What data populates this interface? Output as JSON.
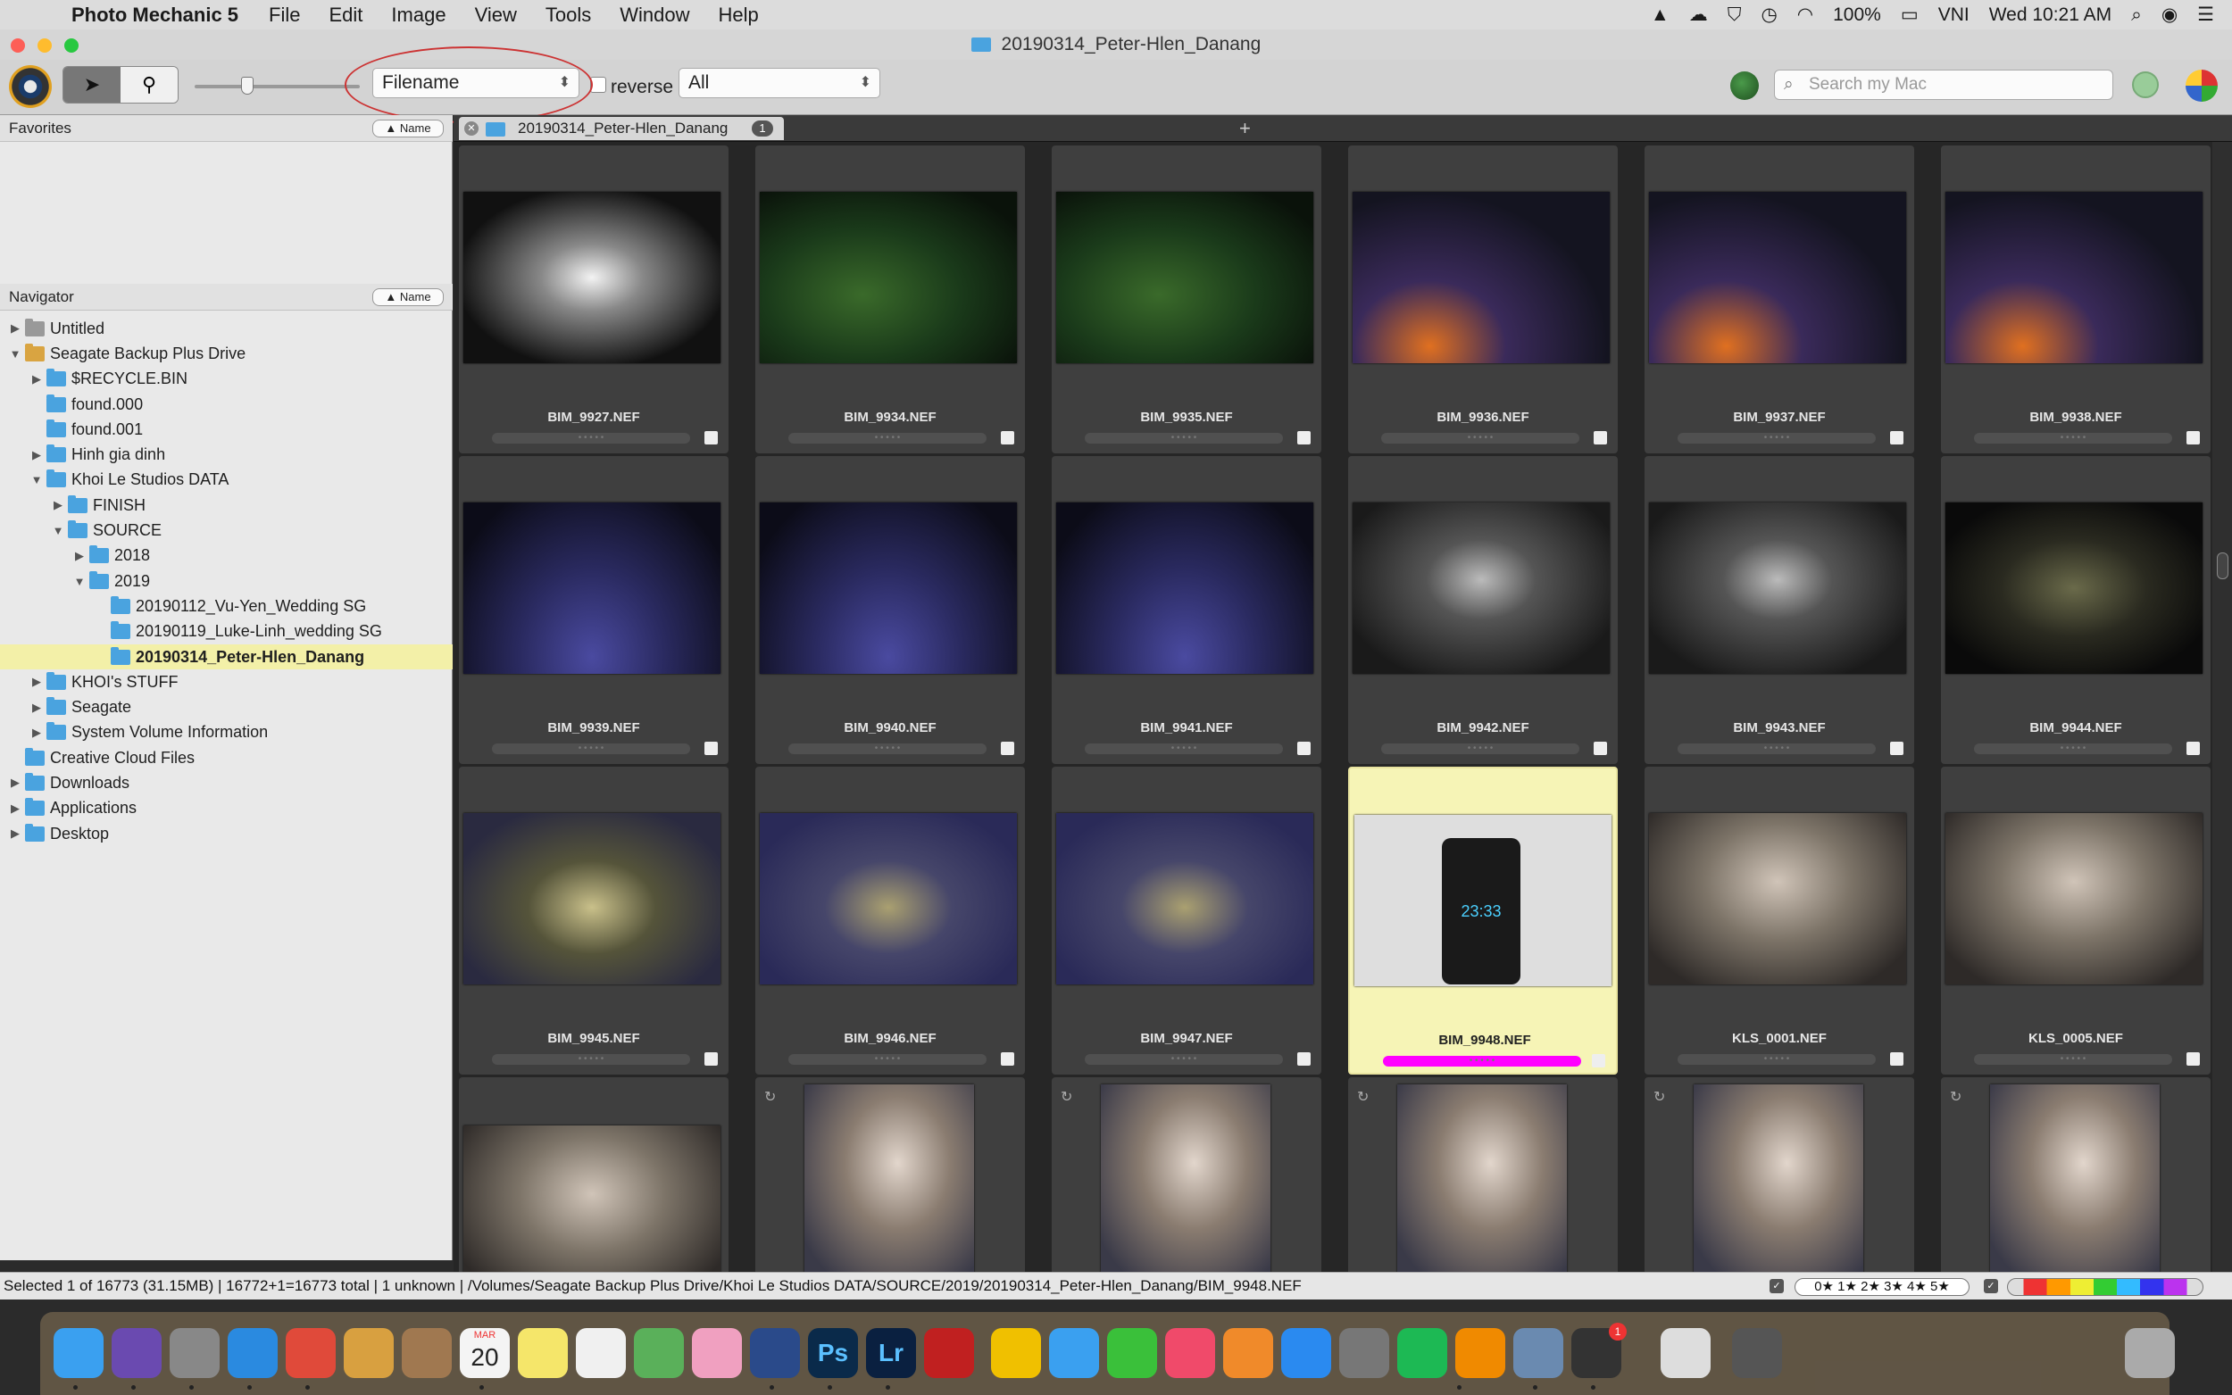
{
  "menubar": {
    "app": "Photo Mechanic 5",
    "items": [
      "File",
      "Edit",
      "Image",
      "View",
      "Tools",
      "Window",
      "Help"
    ],
    "battery": "100%",
    "input_source": "VNI",
    "clock": "Wed 10:21 AM"
  },
  "window": {
    "title": "20190314_Peter-Hlen_Danang"
  },
  "toolbar": {
    "sort_value": "Filename",
    "reverse_label": "reverse",
    "filter_value": "All",
    "search_placeholder": "Search my Mac"
  },
  "favorites": {
    "title": "Favorites",
    "sort_label": "▲ Name"
  },
  "navigator": {
    "title": "Navigator",
    "sort_label": "▲ Name",
    "items": [
      {
        "label": "Untitled",
        "depth": 0,
        "arrow": "▶",
        "kind": "mac"
      },
      {
        "label": "Seagate Backup Plus Drive",
        "depth": 0,
        "arrow": "▼",
        "kind": "drive"
      },
      {
        "label": "$RECYCLE.BIN",
        "depth": 1,
        "arrow": "▶",
        "kind": "folder"
      },
      {
        "label": "found.000",
        "depth": 1,
        "arrow": "",
        "kind": "folder"
      },
      {
        "label": "found.001",
        "depth": 1,
        "arrow": "",
        "kind": "folder"
      },
      {
        "label": "Hinh gia dinh",
        "depth": 1,
        "arrow": "▶",
        "kind": "folder"
      },
      {
        "label": "Khoi Le Studios DATA",
        "depth": 1,
        "arrow": "▼",
        "kind": "folder"
      },
      {
        "label": "FINISH",
        "depth": 2,
        "arrow": "▶",
        "kind": "folder"
      },
      {
        "label": "SOURCE",
        "depth": 2,
        "arrow": "▼",
        "kind": "folder"
      },
      {
        "label": "2018",
        "depth": 3,
        "arrow": "▶",
        "kind": "folder"
      },
      {
        "label": "2019",
        "depth": 3,
        "arrow": "▼",
        "kind": "folder"
      },
      {
        "label": "20190112_Vu-Yen_Wedding SG",
        "depth": 4,
        "arrow": "",
        "kind": "folder"
      },
      {
        "label": "20190119_Luke-Linh_wedding SG",
        "depth": 4,
        "arrow": "",
        "kind": "folder"
      },
      {
        "label": "20190314_Peter-Hlen_Danang",
        "depth": 4,
        "arrow": "",
        "kind": "folder",
        "selected": true
      },
      {
        "label": "KHOI's STUFF",
        "depth": 1,
        "arrow": "▶",
        "kind": "folder"
      },
      {
        "label": "Seagate",
        "depth": 1,
        "arrow": "▶",
        "kind": "folder"
      },
      {
        "label": "System Volume Information",
        "depth": 1,
        "arrow": "▶",
        "kind": "folder"
      },
      {
        "label": "Creative Cloud Files",
        "depth": 0,
        "arrow": "",
        "kind": "folder"
      },
      {
        "label": "Downloads",
        "depth": 0,
        "arrow": "▶",
        "kind": "folder"
      },
      {
        "label": "Applications",
        "depth": 0,
        "arrow": "▶",
        "kind": "folder"
      },
      {
        "label": "Desktop",
        "depth": 0,
        "arrow": "▶",
        "kind": "folder"
      }
    ]
  },
  "tab": {
    "label": "20190314_Peter-Hlen_Danang",
    "count": "1"
  },
  "contact_sheet": [
    {
      "name": "BIM_9927.NEF",
      "style": "th-wedding"
    },
    {
      "name": "BIM_9934.NEF",
      "style": "th-green"
    },
    {
      "name": "BIM_9935.NEF",
      "style": "th-green"
    },
    {
      "name": "BIM_9936.NEF",
      "style": "th-dance"
    },
    {
      "name": "BIM_9937.NEF",
      "style": "th-dance"
    },
    {
      "name": "BIM_9938.NEF",
      "style": "th-dance"
    },
    {
      "name": "BIM_9939.NEF",
      "style": "th-blue"
    },
    {
      "name": "BIM_9940.NEF",
      "style": "th-blue"
    },
    {
      "name": "BIM_9941.NEF",
      "style": "th-blue"
    },
    {
      "name": "BIM_9942.NEF",
      "style": "th-hug"
    },
    {
      "name": "BIM_9943.NEF",
      "style": "th-hug"
    },
    {
      "name": "BIM_9944.NEF",
      "style": "th-dark"
    },
    {
      "name": "BIM_9945.NEF",
      "style": "th-men"
    },
    {
      "name": "BIM_9946.NEF",
      "style": "th-menb"
    },
    {
      "name": "BIM_9947.NEF",
      "style": "th-menb"
    },
    {
      "name": "BIM_9948.NEF",
      "style": "th-phone",
      "selected": true,
      "phone_time": "23:33"
    },
    {
      "name": "KLS_0001.NEF",
      "style": "th-bride"
    },
    {
      "name": "KLS_0005.NEF",
      "style": "th-bride"
    },
    {
      "name": "",
      "style": "th-bride"
    },
    {
      "name": "",
      "style": "th-bridev",
      "portrait": true,
      "rotate": true
    },
    {
      "name": "",
      "style": "th-bridev",
      "portrait": true,
      "rotate": true
    },
    {
      "name": "",
      "style": "th-bridev",
      "portrait": true,
      "rotate": true
    },
    {
      "name": "",
      "style": "th-bridev",
      "portrait": true,
      "rotate": true
    },
    {
      "name": "",
      "style": "th-bridev",
      "portrait": true,
      "rotate": true
    }
  ],
  "status": {
    "text": "Selected 1 of 16773 (31.15MB) | 16772+1=16773 total | 1 unknown | /Volumes/Seagate Backup Plus Drive/Khoi Le Studios DATA/SOURCE/2019/20190314_Peter-Hlen_Danang/BIM_9948.NEF",
    "stars": "0★ 1★ 2★ 3★ 4★ 5★"
  },
  "colors": {
    "selection": "#f6f4b6",
    "color_class": "#ff00ff",
    "folder": "#4aa3df"
  },
  "dock": {
    "icons": [
      "finder-icon",
      "siri-icon",
      "launchpad-icon",
      "safari-icon",
      "chrome-icon",
      "preview-icon",
      "contacts-icon",
      "calendar-icon",
      "notes-icon",
      "reminders-icon",
      "maps-icon",
      "photos-icon",
      "photo-mechanic-icon",
      "photoshop-icon",
      "lightroom-icon",
      "battery-app-icon",
      "sq-icon",
      "messages-icon",
      "facetime-icon",
      "music-icon",
      "books-icon",
      "app-store-icon",
      "system-preferences-icon",
      "spotify-icon",
      "vlc-icon",
      "image-capture-icon",
      "mail-icon",
      "folder-stack-icon",
      "screenshot-stack-icon",
      "trash-icon"
    ],
    "colors": [
      "#3aa0f0",
      "#6a4ab0",
      "#888",
      "#2a8ae0",
      "#e04a3a",
      "#d8a040",
      "#a07850",
      "#f4f4f4",
      "#f5e66a",
      "#f0f0f0",
      "#5ab05a",
      "#f0a0c0",
      "#2a4a8a",
      "#0a2a4a",
      "#0a2040",
      "#c02020",
      "#f0c000",
      "#3aa0f0",
      "#3ac03a",
      "#f04a6a",
      "#f08a2a",
      "#2a8af0",
      "#777",
      "#1db954",
      "#f08a00",
      "#6a8ab0",
      "#333",
      "#ddd",
      "#555",
      "#aaa"
    ],
    "calendar_month": "MAR",
    "calendar_day": "20",
    "ps": "Ps",
    "lr": "Lr",
    "badge": "1"
  }
}
